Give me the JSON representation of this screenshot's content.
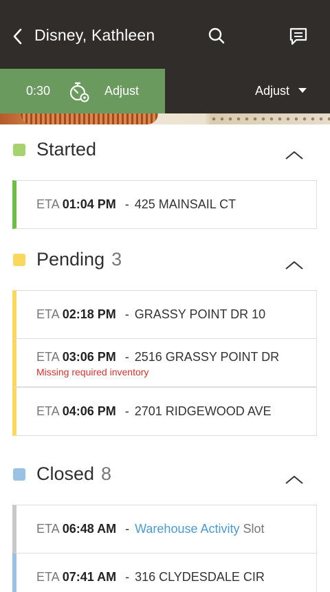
{
  "header": {
    "title": "Disney, Kathleen",
    "icons": {
      "back": "chevron-left-icon",
      "search": "search-icon",
      "chat": "chat-bubble-icon"
    }
  },
  "timer": {
    "value": "0:30",
    "adjust_label": "Adjust",
    "icon": "stopwatch-gear-icon",
    "menu_label": "Adjust"
  },
  "colors": {
    "header_bg": "#312d2a",
    "timer_bg": "#6a9a5e",
    "started": "#a6d36f",
    "pending": "#fad85e",
    "closed": "#99c2e4",
    "link": "#4a9bd0",
    "warning": "#d6312b"
  },
  "sections": {
    "started": {
      "title": "Started",
      "items": [
        {
          "eta_label": "ETA",
          "time": "01:04 PM",
          "separator": "-",
          "address": "425 MAINSAIL CT"
        }
      ]
    },
    "pending": {
      "title": "Pending",
      "count": "3",
      "items": [
        {
          "eta_label": "ETA",
          "time": "02:18 PM",
          "separator": "-",
          "address": "GRASSY POINT DR 10"
        },
        {
          "eta_label": "ETA",
          "time": "03:06 PM",
          "separator": "-",
          "address": "2516 GRASSY POINT DR",
          "warning": "Missing required inventory"
        },
        {
          "eta_label": "ETA",
          "time": "04:06 PM",
          "separator": "-",
          "address": "2701 RIDGEWOOD AVE"
        }
      ]
    },
    "closed": {
      "title": "Closed",
      "count": "8",
      "items": [
        {
          "eta_label": "ETA",
          "time": "06:48 AM",
          "separator": "-",
          "link_text": "Warehouse Activity",
          "suffix": "Slot"
        },
        {
          "eta_label": "ETA",
          "time": "07:41 AM",
          "separator": "-",
          "address": "316 CLYDESDALE CIR"
        }
      ]
    }
  }
}
